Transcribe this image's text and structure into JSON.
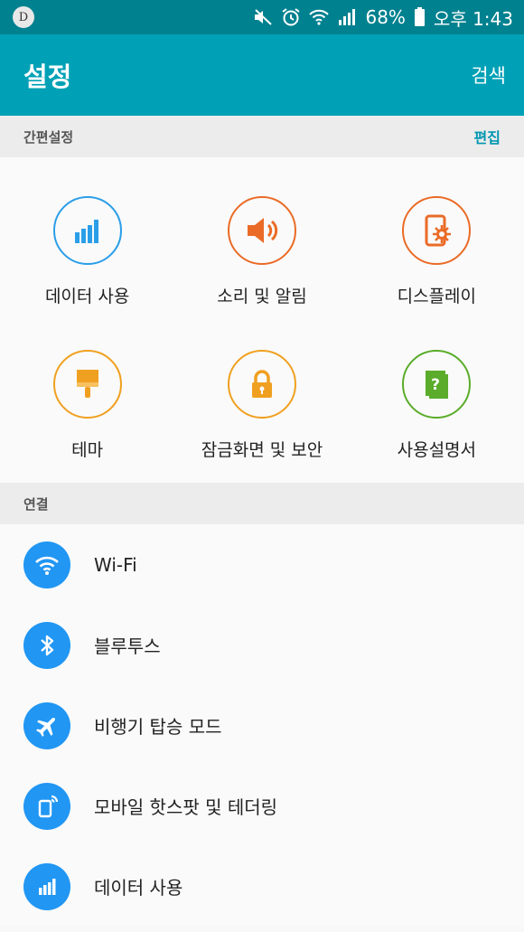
{
  "status_bar": {
    "badge": "D",
    "battery": "68%",
    "time": "오후 1:43"
  },
  "appbar": {
    "title": "설정",
    "search": "검색"
  },
  "quick_settings": {
    "header": "간편설정",
    "edit": "편집",
    "items": [
      {
        "label": "데이터 사용",
        "icon": "data-usage-icon",
        "color": "#2b9ee8"
      },
      {
        "label": "소리 및 알림",
        "icon": "sound-icon",
        "color": "#ea6b27"
      },
      {
        "label": "디스플레이",
        "icon": "display-icon",
        "color": "#ea6b27"
      },
      {
        "label": "테마",
        "icon": "theme-brush-icon",
        "color": "#f0a020"
      },
      {
        "label": "잠금화면 및 보안",
        "icon": "lock-icon",
        "color": "#f0a020"
      },
      {
        "label": "사용설명서",
        "icon": "help-book-icon",
        "color": "#5aac2a"
      }
    ]
  },
  "connections": {
    "header": "연결",
    "items": [
      {
        "label": "Wi-Fi",
        "icon": "wifi-icon"
      },
      {
        "label": "블루투스",
        "icon": "bluetooth-icon"
      },
      {
        "label": "비행기 탑승 모드",
        "icon": "airplane-icon"
      },
      {
        "label": "모바일 핫스팟 및 테더링",
        "icon": "hotspot-icon"
      },
      {
        "label": "데이터 사용",
        "icon": "data-usage-icon"
      }
    ]
  }
}
